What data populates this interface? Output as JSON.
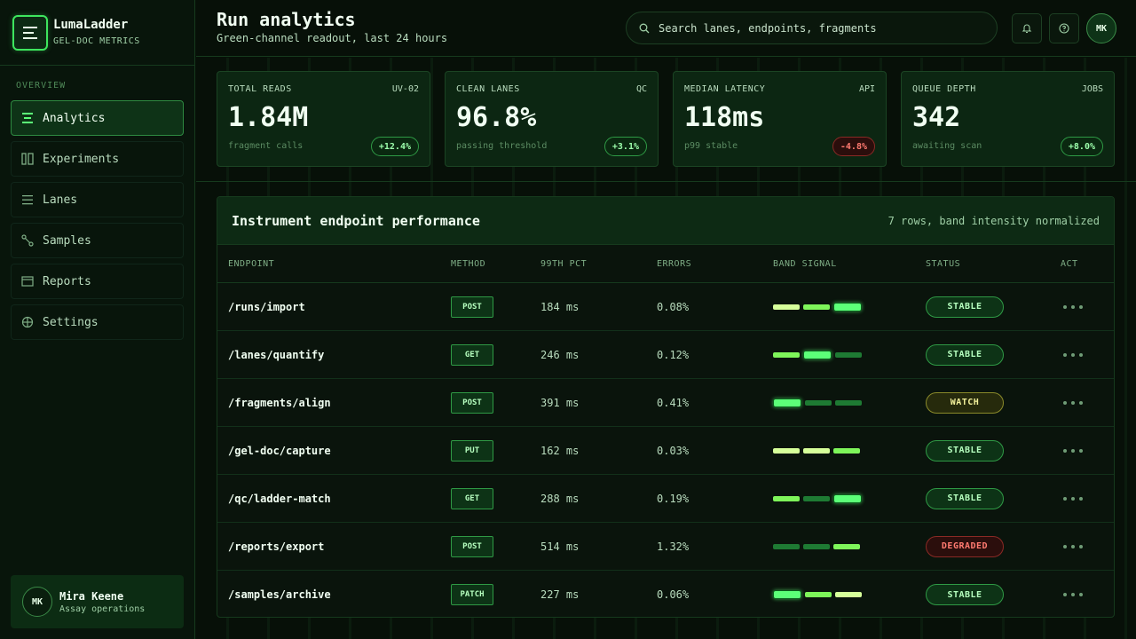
{
  "brand": {
    "name": "LumaLadder",
    "subtitle": "GEL-DOC METRICS"
  },
  "sidebar": {
    "section": "OVERVIEW",
    "items": [
      {
        "label": "Analytics",
        "icon": "bars-icon",
        "active": true
      },
      {
        "label": "Experiments",
        "icon": "columns-icon"
      },
      {
        "label": "Lanes",
        "icon": "list-icon"
      },
      {
        "label": "Samples",
        "icon": "nodes-icon"
      },
      {
        "label": "Reports",
        "icon": "window-icon"
      },
      {
        "label": "Settings",
        "icon": "crosshair-icon"
      }
    ],
    "user": {
      "initials": "MK",
      "name": "Mira Keene",
      "role": "Assay operations"
    }
  },
  "header": {
    "title": "Run analytics",
    "subtitle": "Green-channel readout, last 24 hours",
    "search_placeholder": "Search lanes, endpoints, fragments",
    "avatar_initials": "MK"
  },
  "stats": [
    {
      "label": "TOTAL READS",
      "tag": "UV-02",
      "value": "1.84M",
      "note": "fragment calls",
      "delta": "+12.4%",
      "trend": "up"
    },
    {
      "label": "CLEAN LANES",
      "tag": "QC",
      "value": "96.8%",
      "note": "passing threshold",
      "delta": "+3.1%",
      "trend": "up"
    },
    {
      "label": "MEDIAN LATENCY",
      "tag": "API",
      "value": "118ms",
      "note": "p99 stable",
      "delta": "-4.8%",
      "trend": "down"
    },
    {
      "label": "QUEUE DEPTH",
      "tag": "JOBS",
      "value": "342",
      "note": "awaiting scan",
      "delta": "+8.0%",
      "trend": "up"
    }
  ],
  "table": {
    "title": "Instrument endpoint performance",
    "meta": "7 rows, band intensity normalized",
    "columns": [
      "ENDPOINT",
      "METHOD",
      "99TH PCT",
      "ERRORS",
      "BAND SIGNAL",
      "STATUS",
      "ACT"
    ],
    "rows": [
      {
        "endpoint": "/runs/import",
        "method": "POST",
        "p99": "184 ms",
        "errors": "0.08%",
        "bands": [
          3,
          2,
          4
        ],
        "status": "STABLE"
      },
      {
        "endpoint": "/lanes/quantify",
        "method": "GET",
        "p99": "246 ms",
        "errors": "0.12%",
        "bands": [
          2,
          4,
          1
        ],
        "status": "STABLE"
      },
      {
        "endpoint": "/fragments/align",
        "method": "POST",
        "p99": "391 ms",
        "errors": "0.41%",
        "bands": [
          4,
          1,
          1
        ],
        "status": "WATCH"
      },
      {
        "endpoint": "/gel-doc/capture",
        "method": "PUT",
        "p99": "162 ms",
        "errors": "0.03%",
        "bands": [
          3,
          3,
          2
        ],
        "status": "STABLE"
      },
      {
        "endpoint": "/qc/ladder-match",
        "method": "GET",
        "p99": "288 ms",
        "errors": "0.19%",
        "bands": [
          2,
          1,
          4
        ],
        "status": "STABLE"
      },
      {
        "endpoint": "/reports/export",
        "method": "POST",
        "p99": "514 ms",
        "errors": "1.32%",
        "bands": [
          1,
          1,
          2
        ],
        "status": "DEGRADED"
      },
      {
        "endpoint": "/samples/archive",
        "method": "PATCH",
        "p99": "227 ms",
        "errors": "0.06%",
        "bands": [
          4,
          2,
          3
        ],
        "status": "STABLE"
      }
    ]
  },
  "colors": {
    "accent": "#3ee65e",
    "background": "#071008",
    "stable": "#b6ffbf",
    "watch": "#f2f09a",
    "degraded": "#ff7a70"
  }
}
